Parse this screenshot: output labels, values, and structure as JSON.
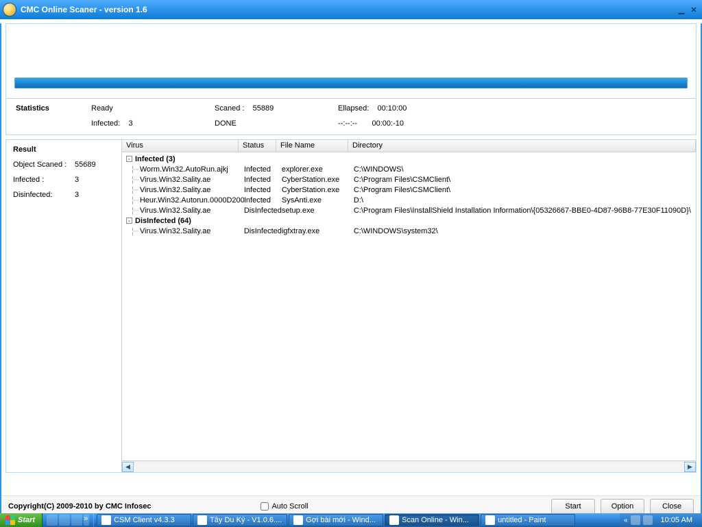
{
  "title": "CMC Online Scaner - version 1.6",
  "stats": {
    "heading": "Statistics",
    "ready": "Ready",
    "scanned_label": "Scaned :",
    "scanned_value": "55889",
    "elapsed_label": "Ellapsed:",
    "elapsed_value": "00:10:00",
    "infected_label": "Infected:",
    "infected_value": "3",
    "done": "DONE",
    "dash_label": "--:--:--",
    "neg_time": "00:00:-10"
  },
  "result": {
    "heading": "Result",
    "obj_scanned_label": "Object Scaned :",
    "obj_scanned_value": "55689",
    "infected_label": "Infected :",
    "infected_value": "3",
    "disinfected_label": "Disinfected:",
    "disinfected_value": "3"
  },
  "columns": {
    "virus": "Virus",
    "status": "Status",
    "file": "File Name",
    "dir": "Directory"
  },
  "groups": {
    "infected": "Infected (3)",
    "disinfected": "DisInfected (64)"
  },
  "rows": [
    {
      "v": "Worm.Win32.AutoRun.ajkj",
      "s": "Infected",
      "f": "explorer.exe",
      "d": "C:\\WINDOWS\\"
    },
    {
      "v": "Virus.Win32.Sality.ae",
      "s": "Infected",
      "f": "CyberStation.exe",
      "d": "C:\\Program Files\\CSMClient\\"
    },
    {
      "v": "Virus.Win32.Sality.ae",
      "s": "Infected",
      "f": "CyberStation.exe",
      "d": "C:\\Program Files\\CSMClient\\"
    },
    {
      "v": "Heur.Win32.Autorun.0000D200",
      "s": "Infected",
      "f": "SysAnti.exe",
      "d": "D:\\"
    },
    {
      "v": "Virus.Win32.Sality.ae",
      "s": "DisInfected",
      "f": "setup.exe",
      "d": "C:\\Program Files\\InstallShield Installation Information\\{05326667-BBE0-4D87-96B8-77E30F11090D}\\"
    }
  ],
  "rows2": [
    {
      "v": "Virus.Win32.Sality.ae",
      "s": "DisInfected",
      "f": "igfxtray.exe",
      "d": "C:\\WINDOWS\\system32\\"
    }
  ],
  "footer": {
    "copyright": "Copyright(C) 2009-2010 by CMC Infosec",
    "autoscroll": "Auto Scroll",
    "start": "Start",
    "option": "Option",
    "close": "Close"
  },
  "taskbar": {
    "start": "Start",
    "tasks": [
      "CSM Client v4.3.3",
      "Tây Du Ký - V1.0.6....",
      "Gợi bài mới - Wind...",
      "Scan Online - Win...",
      "untitled - Paint"
    ],
    "clock": "10:05 AM"
  }
}
